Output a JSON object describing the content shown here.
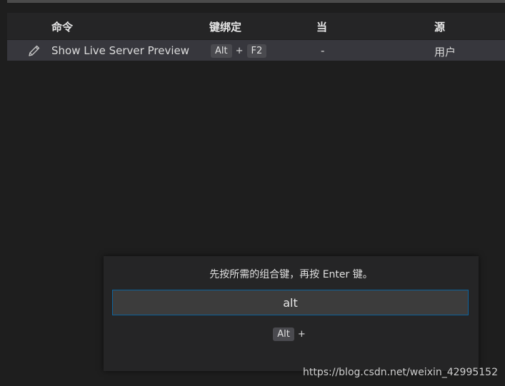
{
  "table": {
    "headers": {
      "command": "命令",
      "keybinding": "键绑定",
      "when": "当",
      "source": "源"
    },
    "rows": [
      {
        "command": "Show Live Server Preview",
        "keys": [
          "Alt",
          "F2"
        ],
        "separator": "+",
        "when": "-",
        "source": "用户",
        "icon": "pencil-icon"
      }
    ]
  },
  "dialog": {
    "message": "先按所需的组合键，再按 Enter 键。",
    "input_value": "alt",
    "captured_keys": [
      "Alt"
    ],
    "captured_separator": "+"
  },
  "watermark": "https://blog.csdn.net/weixin_42995152",
  "colors": {
    "background": "#1e1e1e",
    "selected_row": "#37373d",
    "input_border": "#0e639c",
    "kbd_background": "#4a4a4f"
  }
}
